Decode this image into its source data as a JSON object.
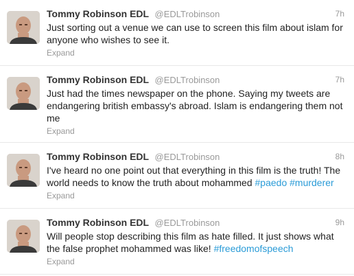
{
  "tweets": [
    {
      "fullname": "Tommy Robinson EDL",
      "username": "@EDLTrobinson",
      "time": "7h",
      "text": "Just sorting out a venue we can use to screen this film about islam for anyone who wishes to see it.",
      "hashtags": [],
      "expand": "Expand"
    },
    {
      "fullname": "Tommy Robinson EDL",
      "username": "@EDLTrobinson",
      "time": "7h",
      "text": "Just had the times newspaper on the phone. Saying my tweets are endangering british embassy's abroad. Islam is endangering them not me",
      "hashtags": [],
      "expand": "Expand"
    },
    {
      "fullname": "Tommy Robinson EDL",
      "username": "@EDLTrobinson",
      "time": "8h",
      "text": "I've heard no one point out that everything in this film is the truth! The world needs to know the truth about mohammed",
      "hashtags": [
        "#paedo",
        "#murderer"
      ],
      "expand": "Expand"
    },
    {
      "fullname": "Tommy Robinson EDL",
      "username": "@EDLTrobinson",
      "time": "9h",
      "text": "Will people stop describing this film as hate filled. It just shows what the false prophet mohammed was like!",
      "hashtags": [
        "#freedomofspeech"
      ],
      "expand": "Expand"
    }
  ],
  "colors": {
    "hashtag": "#2a9bd7",
    "meta": "#999999",
    "divider": "#e8e8e8"
  }
}
